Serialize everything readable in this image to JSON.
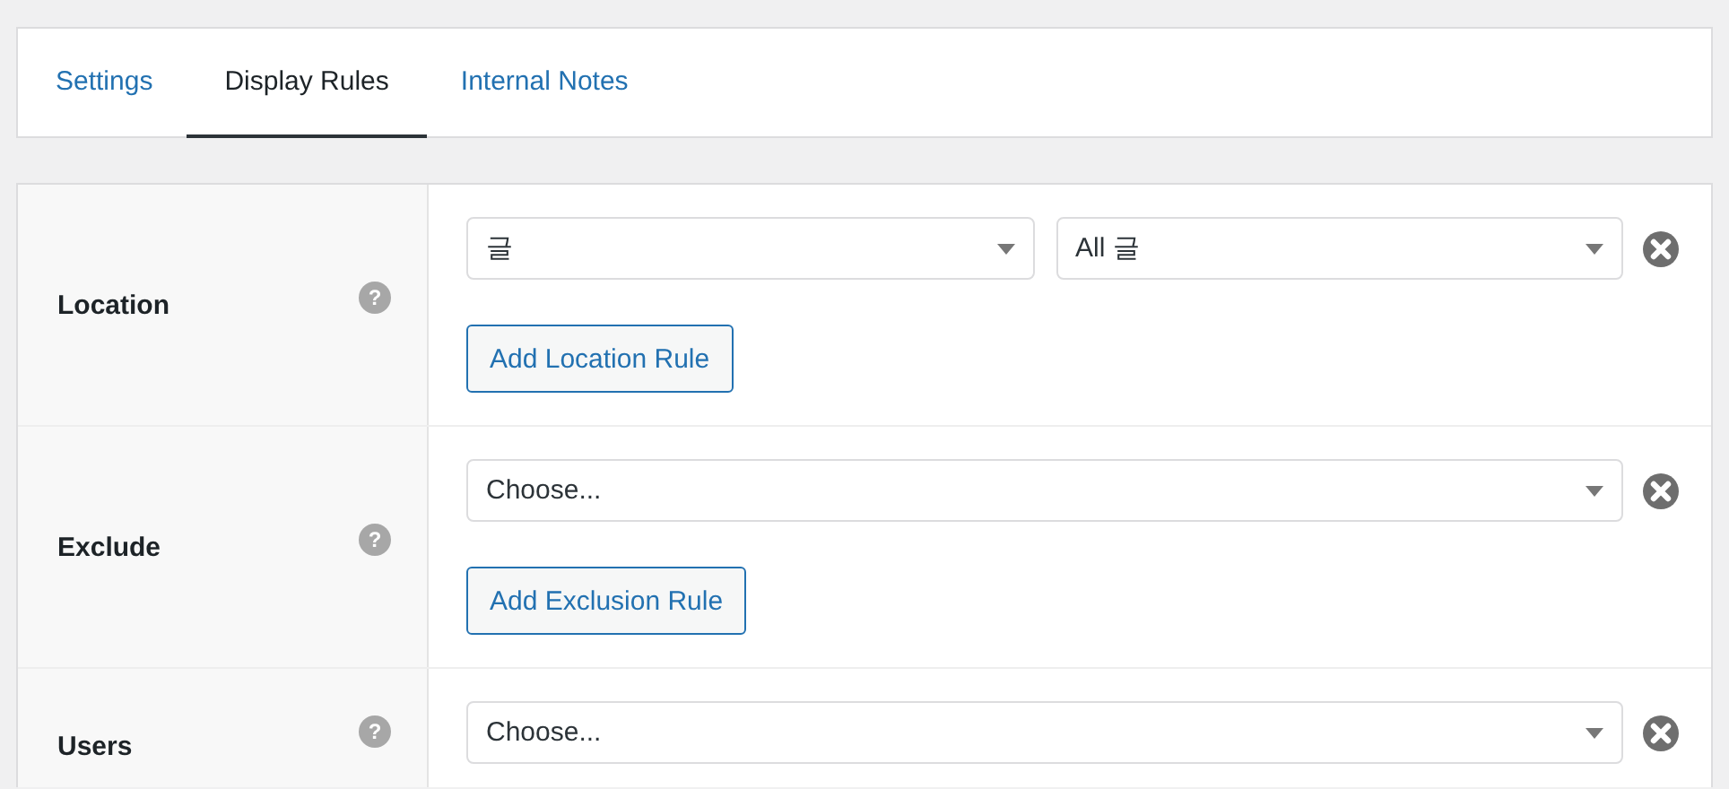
{
  "tabs": [
    {
      "label": "Settings",
      "selected": false
    },
    {
      "label": "Display Rules",
      "selected": true
    },
    {
      "label": "Internal Notes",
      "selected": false
    }
  ],
  "rules": [
    {
      "label": "Location",
      "help": "?",
      "selects": [
        {
          "value": "글"
        },
        {
          "value": "All 글"
        }
      ],
      "button": "Add Location Rule"
    },
    {
      "label": "Exclude",
      "help": "?",
      "selects": [
        {
          "value": "Choose..."
        }
      ],
      "button": "Add Exclusion Rule"
    },
    {
      "label": "Users",
      "help": "?",
      "selects": [
        {
          "value": "Choose..."
        }
      ]
    }
  ]
}
